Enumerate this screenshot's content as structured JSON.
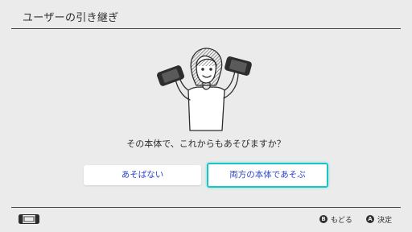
{
  "header": {
    "title": "ユーザーの引き継ぎ"
  },
  "dialog": {
    "question": "その本体で、これからもあそびますか？",
    "buttons": {
      "no_label": "あそばない",
      "yes_label": "両方の本体であそぶ"
    }
  },
  "footer": {
    "back": {
      "glyph": "B",
      "label": "もどる"
    },
    "confirm": {
      "glyph": "A",
      "label": "決定"
    }
  },
  "colors": {
    "background": "#ebebeb",
    "text": "#2d2d2d",
    "button_text": "#2b45c8",
    "focus_border": "#19c5c5"
  },
  "icons": [
    "person-holding-consoles-illustration",
    "controller-icon"
  ]
}
